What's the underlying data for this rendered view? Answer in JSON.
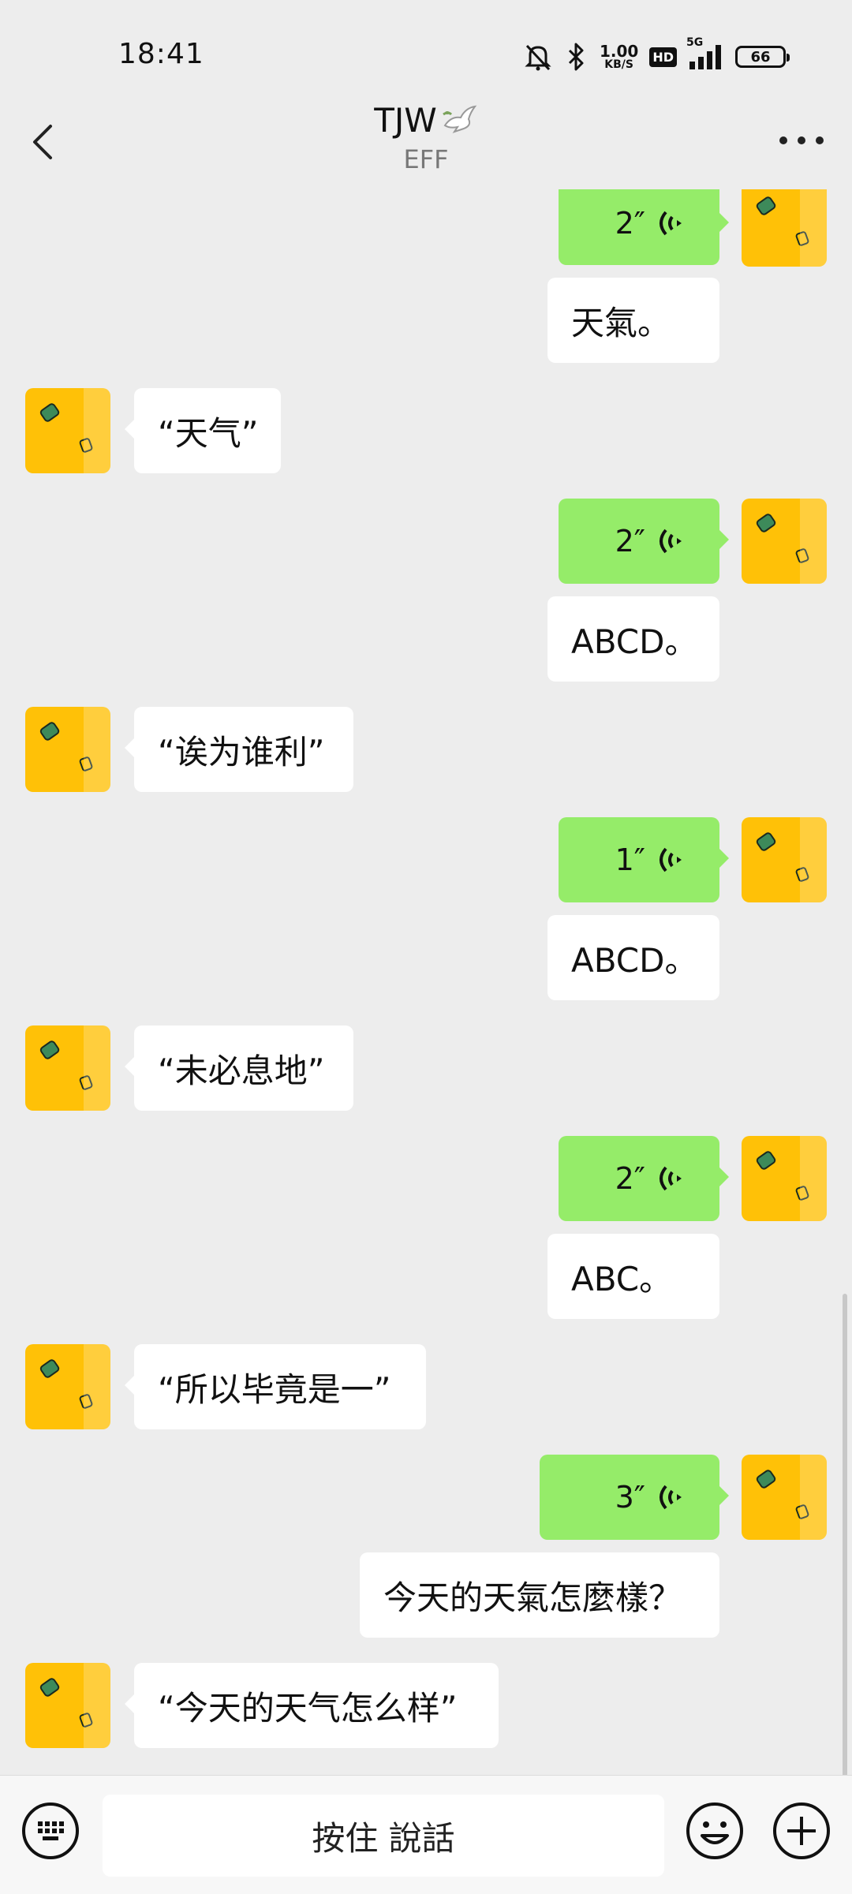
{
  "status_bar": {
    "time": "18:41",
    "net_speed_value": "1.00",
    "net_speed_unit": "KB/S",
    "hd_label": "HD",
    "network_label": "5G",
    "battery": "66",
    "icons": [
      "mute-icon",
      "bluetooth-icon",
      "signal-icon",
      "battery-icon"
    ]
  },
  "header": {
    "title": "TJW",
    "subtitle": "EFF",
    "icons": [
      "back-icon",
      "dove-icon",
      "more-icon"
    ]
  },
  "messages": [
    {
      "side": "right",
      "type": "voice",
      "duration": "2″"
    },
    {
      "side": "right",
      "type": "text",
      "text": "天氣。"
    },
    {
      "side": "left",
      "type": "text",
      "text": "“天气”"
    },
    {
      "side": "right",
      "type": "voice",
      "duration": "2″"
    },
    {
      "side": "right",
      "type": "text",
      "text": "ABCD。"
    },
    {
      "side": "left",
      "type": "text",
      "text": "“诶为谁利”"
    },
    {
      "side": "right",
      "type": "voice",
      "duration": "1″"
    },
    {
      "side": "right",
      "type": "text",
      "text": "ABCD。"
    },
    {
      "side": "left",
      "type": "text",
      "text": "“未必息地”"
    },
    {
      "side": "right",
      "type": "voice",
      "duration": "2″"
    },
    {
      "side": "right",
      "type": "text",
      "text": "ABC。"
    },
    {
      "side": "left",
      "type": "text",
      "text": "“所以毕竟是一”"
    },
    {
      "side": "right",
      "type": "voice",
      "duration": "3″"
    },
    {
      "side": "right",
      "type": "text",
      "text": "今天的天氣怎麼樣？"
    },
    {
      "side": "left",
      "type": "text",
      "text": "“今天的天气怎么样”"
    }
  ],
  "bottom_bar": {
    "hold_to_talk": "按住 說話",
    "icons": [
      "keyboard-icon",
      "emoji-icon",
      "plus-icon"
    ]
  },
  "colors": {
    "background": "#ededed",
    "sent_bubble": "#95ec69",
    "received_bubble": "#ffffff",
    "avatar": "#ffc107"
  }
}
